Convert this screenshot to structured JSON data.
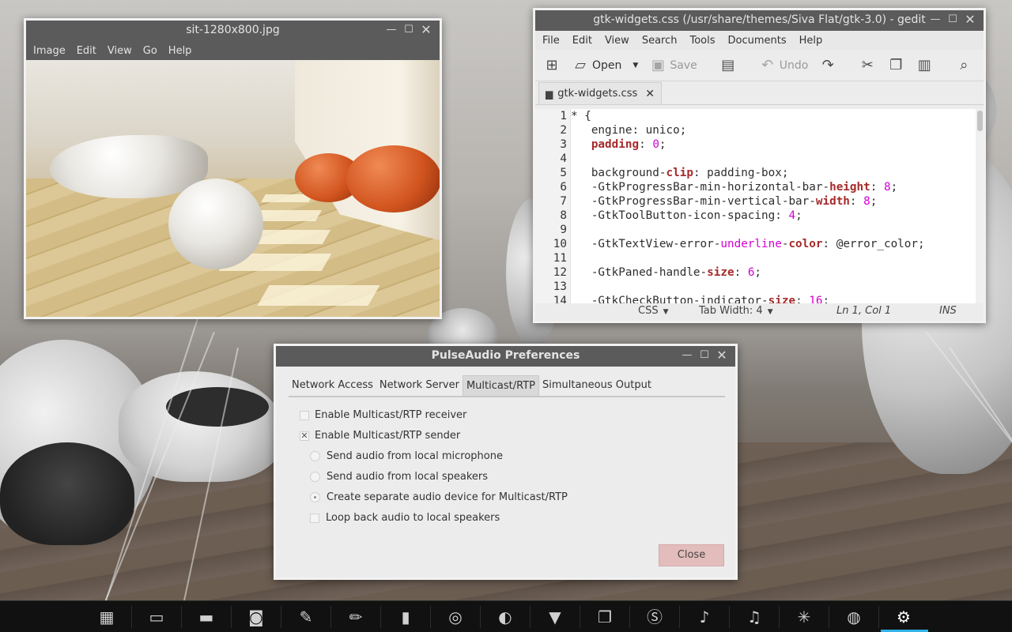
{
  "viewer": {
    "title": "sit-1280x800.jpg",
    "menu": [
      "Image",
      "Edit",
      "View",
      "Go",
      "Help"
    ]
  },
  "gedit": {
    "title": "gtk-widgets.css (/usr/share/themes/Siva Flat/gtk-3.0) - gedit",
    "menu": [
      "File",
      "Edit",
      "View",
      "Search",
      "Tools",
      "Documents",
      "Help"
    ],
    "toolbar": {
      "new_icon": "document-new-icon",
      "open_label": "Open",
      "save_label": "Save",
      "undo_label": "Undo"
    },
    "tab_label": "gtk-widgets.css",
    "lines": [
      {
        "n": "1",
        "parts": [
          [
            "",
            "* {"
          ]
        ]
      },
      {
        "n": "2",
        "parts": [
          [
            "",
            "   engine: unico;"
          ]
        ]
      },
      {
        "n": "3",
        "parts": [
          [
            "",
            "   "
          ],
          [
            "k",
            "padding"
          ],
          [
            "",
            ": "
          ],
          [
            "m",
            "0"
          ],
          [
            "",
            ";"
          ]
        ]
      },
      {
        "n": "4",
        "parts": [
          [
            "",
            ""
          ]
        ]
      },
      {
        "n": "5",
        "parts": [
          [
            "",
            "   background-"
          ],
          [
            "k",
            "clip"
          ],
          [
            "",
            ": padding-box;"
          ]
        ]
      },
      {
        "n": "6",
        "parts": [
          [
            "",
            "   -GtkProgressBar-min-horizontal-bar-"
          ],
          [
            "k",
            "height"
          ],
          [
            "",
            ": "
          ],
          [
            "m",
            "8"
          ],
          [
            "",
            ";"
          ]
        ]
      },
      {
        "n": "7",
        "parts": [
          [
            "",
            "   -GtkProgressBar-min-vertical-bar-"
          ],
          [
            "k",
            "width"
          ],
          [
            "",
            ": "
          ],
          [
            "m",
            "8"
          ],
          [
            "",
            ";"
          ]
        ]
      },
      {
        "n": "8",
        "parts": [
          [
            "",
            "   -GtkToolButton-icon-spacing: "
          ],
          [
            "m",
            "4"
          ],
          [
            "",
            ";"
          ]
        ]
      },
      {
        "n": "9",
        "parts": [
          [
            "",
            ""
          ]
        ]
      },
      {
        "n": "10",
        "parts": [
          [
            "",
            "   -GtkTextView-error-"
          ],
          [
            "m",
            "underline"
          ],
          [
            "",
            "-"
          ],
          [
            "k",
            "color"
          ],
          [
            "",
            ": @error_color;"
          ]
        ]
      },
      {
        "n": "11",
        "parts": [
          [
            "",
            ""
          ]
        ]
      },
      {
        "n": "12",
        "parts": [
          [
            "",
            "   -GtkPaned-handle-"
          ],
          [
            "k",
            "size"
          ],
          [
            "",
            ": "
          ],
          [
            "m",
            "6"
          ],
          [
            "",
            ";"
          ]
        ]
      },
      {
        "n": "13",
        "parts": [
          [
            "",
            ""
          ]
        ]
      },
      {
        "n": "14",
        "parts": [
          [
            "",
            "   -GtkCheckButton-indicator-"
          ],
          [
            "k",
            "size"
          ],
          [
            "",
            ": "
          ],
          [
            "m",
            "16"
          ],
          [
            "",
            ";"
          ]
        ]
      }
    ],
    "status": {
      "language": "CSS",
      "tab_width": "Tab Width:  4",
      "position": "Ln 1, Col 1",
      "mode": "INS"
    }
  },
  "pulse": {
    "title": "PulseAudio Preferences",
    "tabs": [
      "Network Access",
      "Network Server",
      "Multicast/RTP",
      "Simultaneous Output"
    ],
    "active_tab": "Multicast/RTP",
    "options": {
      "receiver": {
        "label": "Enable Multicast/RTP receiver",
        "checked": false
      },
      "sender": {
        "label": "Enable Multicast/RTP sender",
        "checked": true
      },
      "mic": {
        "label": "Send audio from local microphone",
        "selected": false
      },
      "speakers": {
        "label": "Send audio from local speakers",
        "selected": false
      },
      "device": {
        "label": "Create separate audio device for Multicast/RTP",
        "selected": true
      },
      "loopback": {
        "label": "Loop back audio to local speakers",
        "checked": false
      }
    },
    "close_label": "Close"
  },
  "dock": {
    "items": [
      {
        "name": "calculator-icon",
        "glyph": "▦"
      },
      {
        "name": "display-icon",
        "glyph": "▭"
      },
      {
        "name": "file-manager-icon",
        "glyph": "▬"
      },
      {
        "name": "camera-icon",
        "glyph": "◙"
      },
      {
        "name": "paint-palette-icon",
        "glyph": "✎"
      },
      {
        "name": "pen-icon",
        "glyph": "✏"
      },
      {
        "name": "book-icon",
        "glyph": "▮"
      },
      {
        "name": "chrome-browser-icon",
        "glyph": "◎"
      },
      {
        "name": "firefox-icon",
        "glyph": "◐"
      },
      {
        "name": "paint-roller-icon",
        "glyph": "▼"
      },
      {
        "name": "chat-icon",
        "glyph": "❐"
      },
      {
        "name": "skype-icon",
        "glyph": "Ⓢ"
      },
      {
        "name": "music-note-icon",
        "glyph": "♪"
      },
      {
        "name": "music-player-icon",
        "glyph": "♫"
      },
      {
        "name": "atom-icon",
        "glyph": "✳"
      },
      {
        "name": "disk-icon",
        "glyph": "◍"
      },
      {
        "name": "settings-gear-icon",
        "glyph": "⚙"
      }
    ],
    "active_item": "settings-gear-icon"
  }
}
